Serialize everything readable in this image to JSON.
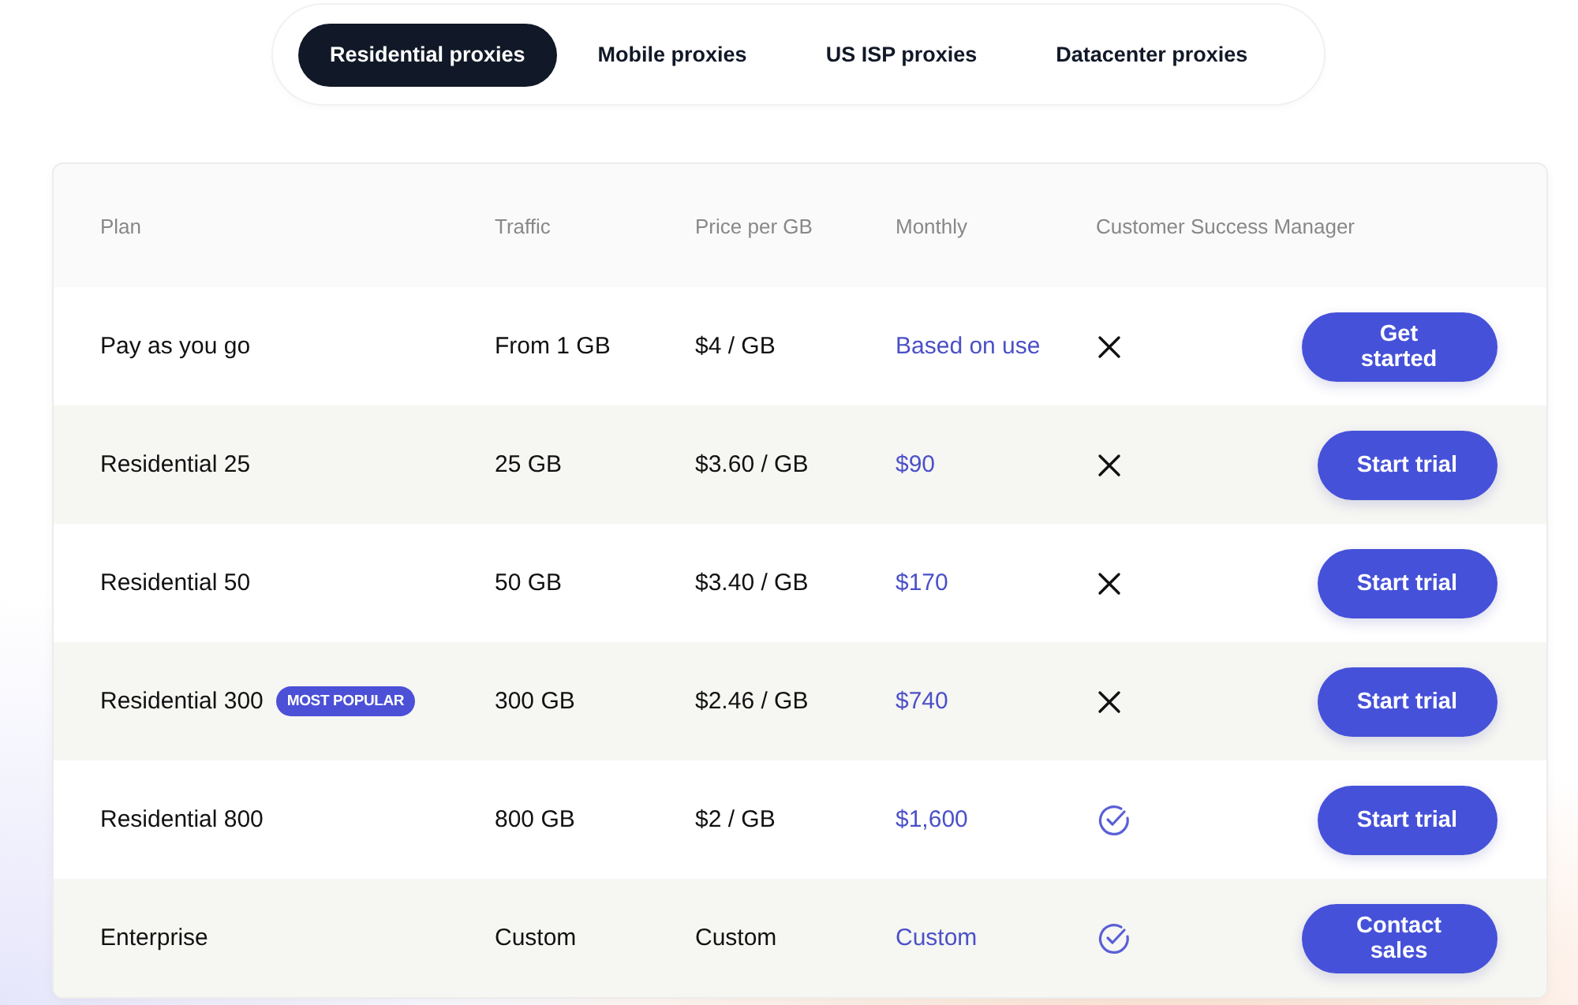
{
  "tabs": [
    {
      "label": "Residential proxies",
      "selected": true
    },
    {
      "label": "Mobile proxies",
      "selected": false
    },
    {
      "label": "US ISP proxies",
      "selected": false
    },
    {
      "label": "Datacenter proxies",
      "selected": false
    }
  ],
  "table": {
    "columns": [
      "Plan",
      "Traffic",
      "Price per GB",
      "Monthly",
      "Customer Success Manager"
    ],
    "rows": [
      {
        "plan": "Pay as you go",
        "traffic": "From 1 GB",
        "price": "$4 / GB",
        "monthly": "Based on use",
        "csm": false,
        "action": "Get started"
      },
      {
        "plan": "Residential 25",
        "traffic": "25 GB",
        "price": "$3.60 / GB",
        "monthly": "$90",
        "csm": false,
        "action": "Start trial"
      },
      {
        "plan": "Residential 50",
        "traffic": "50 GB",
        "price": "$3.40 / GB",
        "monthly": "$170",
        "csm": false,
        "action": "Start trial"
      },
      {
        "plan": "Residential 300",
        "badge": "MOST POPULAR",
        "traffic": "300 GB",
        "price": "$2.46 / GB",
        "monthly": "$740",
        "csm": false,
        "action": "Start trial"
      },
      {
        "plan": "Residential 800",
        "traffic": "800 GB",
        "price": "$2 / GB",
        "monthly": "$1,600",
        "csm": true,
        "action": "Start trial"
      },
      {
        "plan": "Enterprise",
        "traffic": "Custom",
        "price": "Custom",
        "monthly": "Custom",
        "csm": true,
        "action": "Contact sales"
      }
    ]
  }
}
